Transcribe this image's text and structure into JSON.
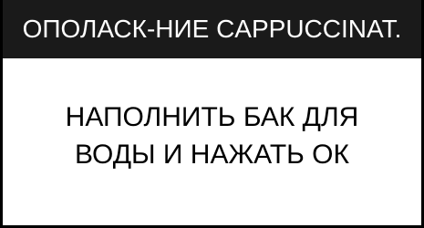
{
  "header": {
    "title": "ОПОЛАСК-НИЕ CAPPUCCINAT."
  },
  "message": {
    "line1": "НАПОЛНИТЬ БАК ДЛЯ",
    "line2": "ВОДЫ И НАЖАТЬ ОК"
  },
  "colors": {
    "header_background": "#1a1a1a",
    "header_text": "#ffffff",
    "screen_background": "#ffffff",
    "text": "#000000"
  }
}
